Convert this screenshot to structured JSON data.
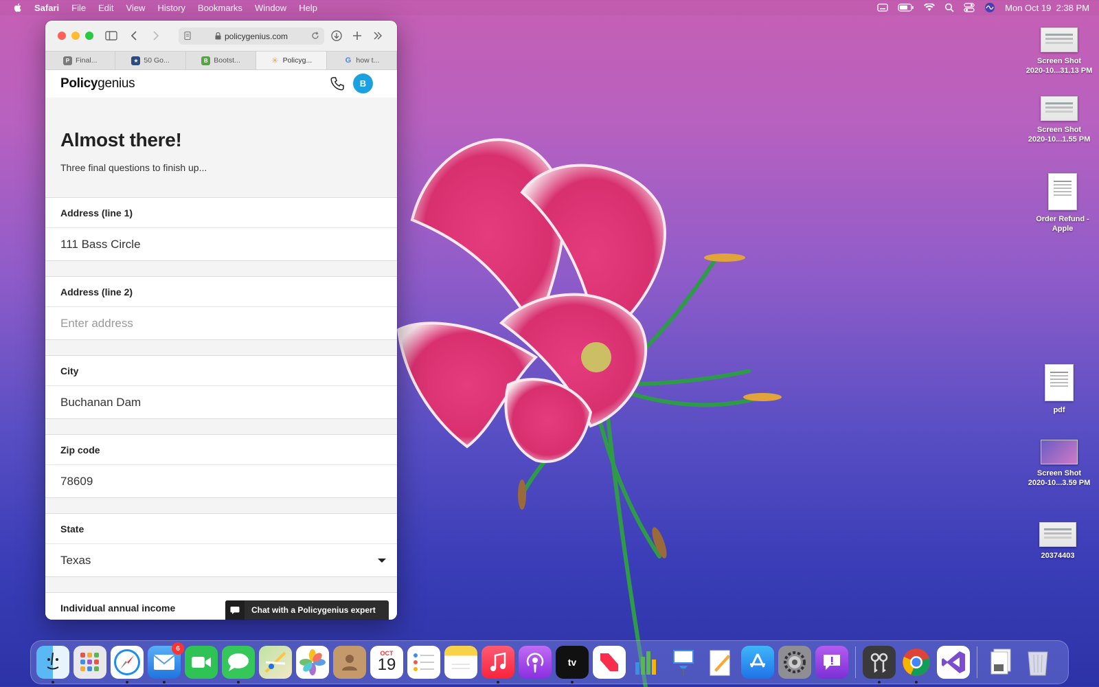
{
  "menubar": {
    "app_name": "Safari",
    "items": [
      "File",
      "Edit",
      "View",
      "History",
      "Bookmarks",
      "Window",
      "Help"
    ],
    "clock": "Mon Oct 19  2:38 PM"
  },
  "browser": {
    "url": "policygenius.com",
    "tabs": [
      {
        "label": "Final...",
        "favicon": "P",
        "color": "#7a7a7a",
        "active": false
      },
      {
        "label": "50 Go...",
        "favicon": "★",
        "color": "#2b4b7d",
        "active": false
      },
      {
        "label": "Bootst...",
        "favicon": "B",
        "color": "#5aa04a",
        "active": false
      },
      {
        "label": "Policyg...",
        "favicon": "✳",
        "color": "#f0a33a",
        "active": true
      },
      {
        "label": "how t...",
        "favicon": "G",
        "color": "#4285f4",
        "active": false
      }
    ]
  },
  "site": {
    "logo_bold": "Policy",
    "logo_light": "genius",
    "avatar_initial": "B"
  },
  "form": {
    "heading": "Almost there!",
    "subheading": "Three final questions to finish up...",
    "address1": {
      "label": "Address (line 1)",
      "value": "111 Bass Circle"
    },
    "address2": {
      "label": "Address (line 2)",
      "placeholder": "Enter address"
    },
    "city": {
      "label": "City",
      "value": "Buchanan Dam"
    },
    "zip": {
      "label": "Zip code",
      "value": "78609"
    },
    "state": {
      "label": "State",
      "value": "Texas"
    },
    "income": {
      "label": "Individual annual income"
    }
  },
  "chat": {
    "label": "Chat with a Policygenius expert"
  },
  "desktop": {
    "icons": [
      {
        "label_line1": "Screen Shot",
        "label_line2": "2020-10...31.13 PM"
      },
      {
        "label_line1": "Screen Shot",
        "label_line2": "2020-10...1.55 PM"
      },
      {
        "label_line1": "Order Refund -",
        "label_line2": "Apple"
      },
      {
        "label_line1": "pdf",
        "label_line2": ""
      },
      {
        "label_line1": "Screen Shot",
        "label_line2": "2020-10...3.59 PM"
      },
      {
        "label_line1": "20374403",
        "label_line2": ""
      }
    ]
  },
  "dock": {
    "mail_badge": "6",
    "calendar_month": "OCT",
    "calendar_day": "19",
    "apps": [
      "Finder",
      "Launchpad",
      "Safari",
      "Mail",
      "FaceTime",
      "Messages",
      "Maps",
      "Photos",
      "Contacts",
      "Calendar",
      "Reminders",
      "Notes",
      "Music",
      "Podcasts",
      "TV",
      "News",
      "Numbers",
      "Keynote",
      "Pages",
      "App Store",
      "System Preferences",
      "Feedback Assistant",
      "Keychain Access",
      "Chrome",
      "Visual Studio",
      "Preview",
      "Trash"
    ]
  }
}
